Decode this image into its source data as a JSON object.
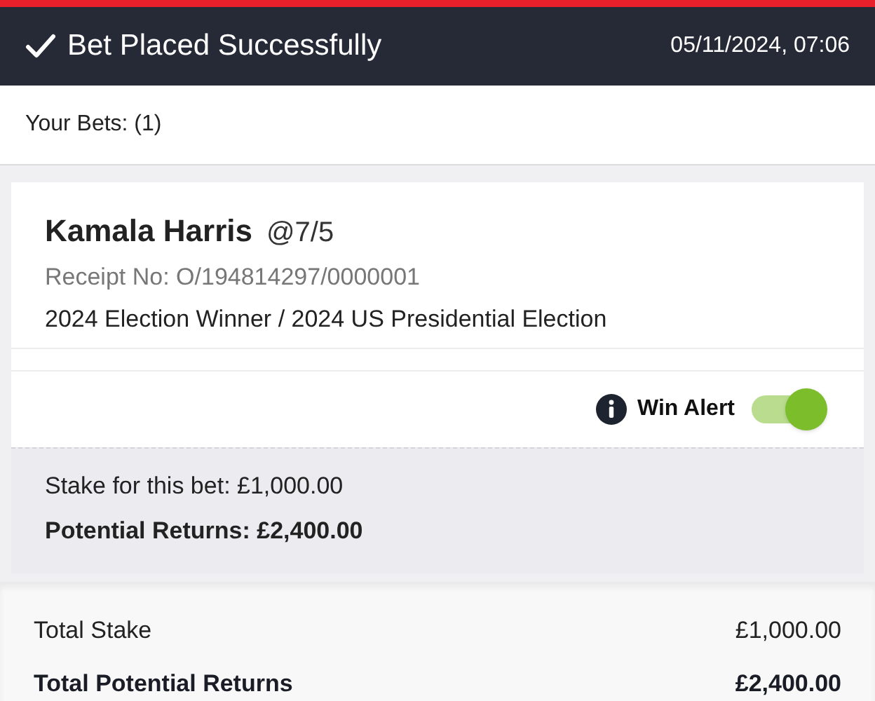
{
  "header": {
    "title": "Bet Placed Successfully",
    "timestamp": "05/11/2024, 07:06"
  },
  "bets_heading": "Your Bets: (1)",
  "bets": [
    {
      "selection": "Kamala Harris",
      "odds": "@7/5",
      "receipt": "Receipt No: O/194814297/0000001",
      "market": "2024 Election Winner / 2024 US Presidential Election",
      "win_alert": {
        "label": "Win Alert",
        "on": true
      },
      "stake": "Stake for this bet: £1,000.00",
      "potential_returns": "Potential Returns: £2,400.00"
    }
  ],
  "totals": [
    {
      "label": "Total Stake",
      "value": "£1,000.00",
      "kind": "regular"
    },
    {
      "label": "Total Potential Returns",
      "value": "£2,400.00",
      "kind": "bold"
    }
  ]
}
